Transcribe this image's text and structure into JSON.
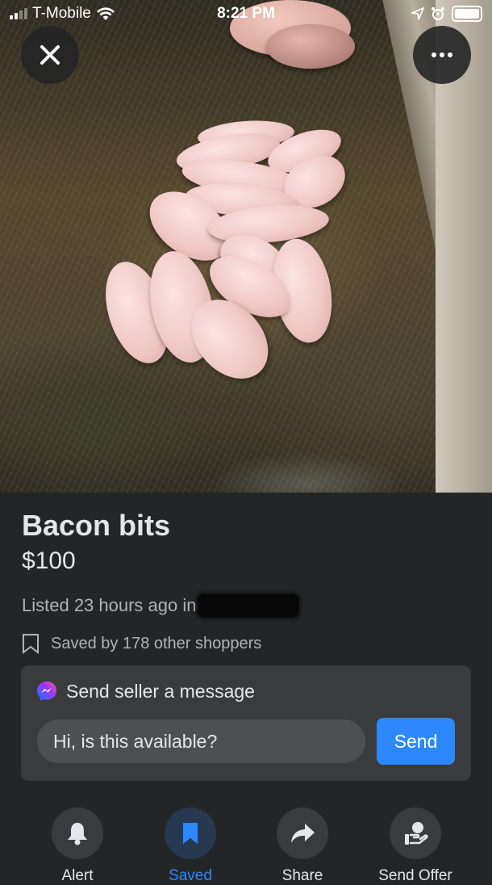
{
  "status_bar": {
    "carrier": "T-Mobile",
    "time": "8:21 PM"
  },
  "listing": {
    "title": "Bacon bits",
    "price": "$100",
    "listed_text": "Listed 23 hours ago in",
    "saved_text": "Saved by 178 other shoppers"
  },
  "message": {
    "header": "Send seller a message",
    "input_value": "Hi, is this available?",
    "send_label": "Send"
  },
  "actions": [
    {
      "label": "Alert",
      "icon": "bell-icon",
      "active": false
    },
    {
      "label": "Saved",
      "icon": "bookmark-icon",
      "active": true
    },
    {
      "label": "Share",
      "icon": "share-arrow-icon",
      "active": false
    },
    {
      "label": "Send Offer",
      "icon": "offer-hand-icon",
      "active": false
    }
  ],
  "colors": {
    "accent": "#2d88ff",
    "background": "#242526",
    "card": "#3a3b3c"
  }
}
